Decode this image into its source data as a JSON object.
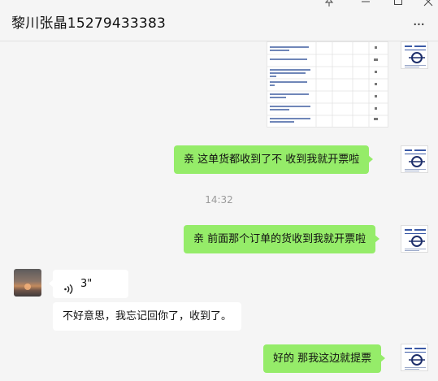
{
  "window": {
    "controls": {
      "pin": "pin-icon",
      "minimize": "minimize-icon",
      "maximize": "maximize-icon",
      "close": "close-icon"
    }
  },
  "header": {
    "title": "黎川张晶15279433383",
    "more_icon": "more-icon"
  },
  "messages": [
    {
      "type": "image",
      "side": "right",
      "content_kind": "order-list-screenshot"
    },
    {
      "type": "text",
      "side": "right",
      "text": "亲  这单货都收到了不  收到我就开票啦"
    },
    {
      "type": "timestamp",
      "text": "14:32"
    },
    {
      "type": "text",
      "side": "right",
      "text": "亲 前面那个订单的货收到我就开票啦"
    },
    {
      "type": "voice",
      "side": "left",
      "duration": "3\""
    },
    {
      "type": "text",
      "side": "left",
      "text": "不好意思，我忘记回你了，收到了。"
    },
    {
      "type": "text",
      "side": "right",
      "text": "好的 那我这边就提票"
    }
  ],
  "colors": {
    "background": "#f5f5f5",
    "self_bubble": "#95ec69",
    "other_bubble": "#ffffff",
    "timestamp": "#9a9a9a"
  }
}
